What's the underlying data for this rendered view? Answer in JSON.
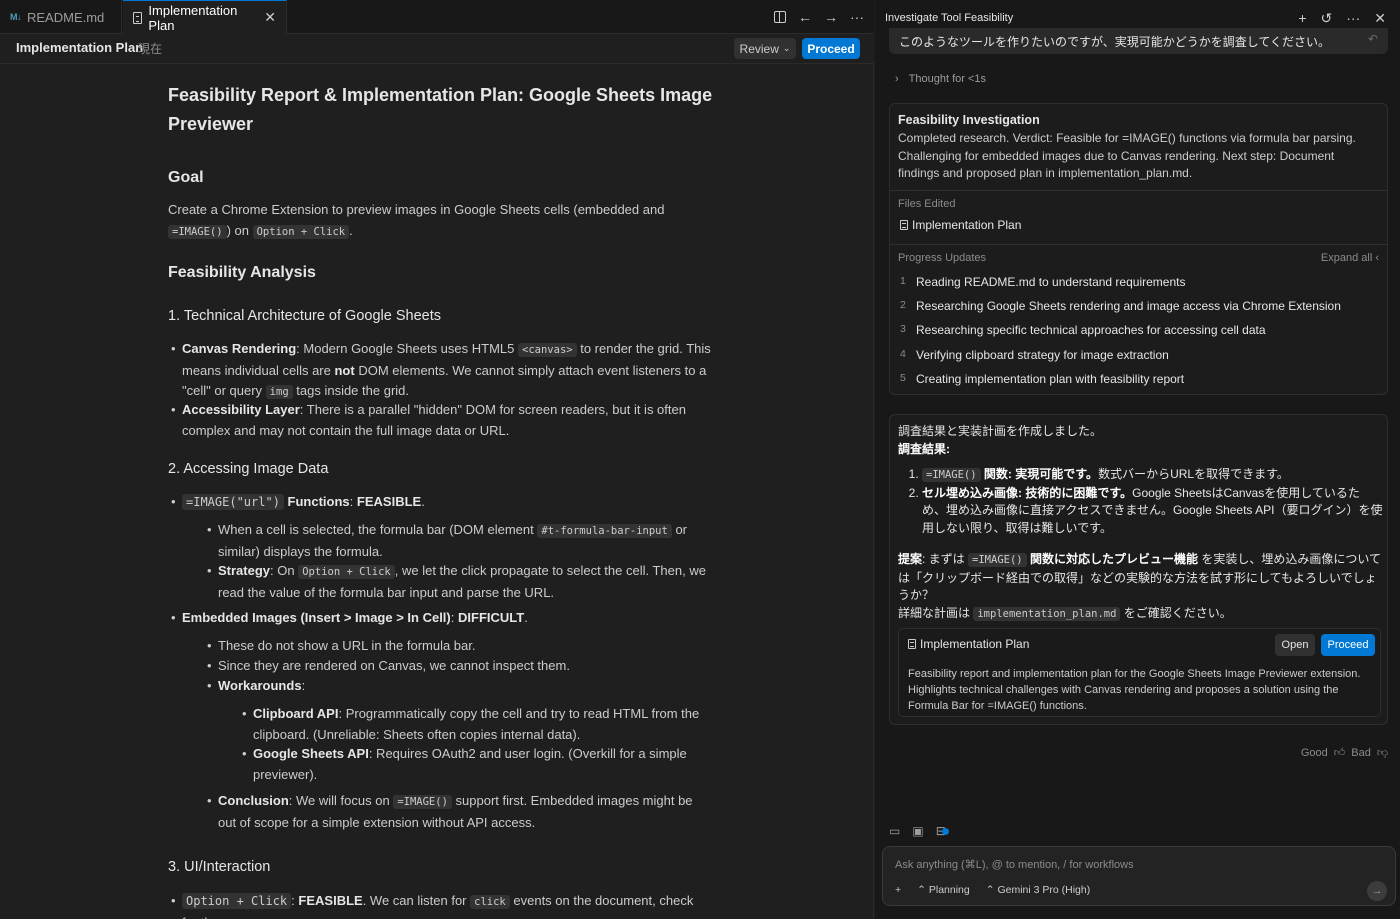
{
  "tabs": [
    {
      "label": "README.md",
      "icon": "markdown-icon"
    },
    {
      "label": "Implementation Plan",
      "icon": "file-icon"
    }
  ],
  "plan_header": {
    "title": "Implementation Plan",
    "badge": "現在",
    "review_label": "Review",
    "proceed_label": "Proceed"
  },
  "doc": {
    "title": "Feasibility Report & Implementation Plan: Google Sheets Image Previewer",
    "goal_heading": "Goal",
    "goal_text_a": "Create a Chrome Extension to preview images in Google Sheets cells (embedded and",
    "goal_code_1": "=IMAGE()",
    "goal_text_b": ") on",
    "goal_code_2": "Option + Click",
    "goal_text_c": ".",
    "feasibility_heading": "Feasibility Analysis",
    "s1_heading": "1. Technical Architecture of Google Sheets",
    "s1_b1_bold": "Canvas Rendering",
    "s1_b1_a": ": Modern Google Sheets uses HTML5",
    "s1_b1_code": "<canvas>",
    "s1_b1_b": "to render the grid. This means individual cells are",
    "s1_b1_not": "not",
    "s1_b1_c": "DOM elements. We cannot simply attach event listeners to a \"cell\" or query",
    "s1_b1_code2": "img",
    "s1_b1_d": "tags inside the grid.",
    "s1_b2_bold": "Accessibility Layer",
    "s1_b2_text": ": There is a parallel \"hidden\" DOM for screen readers, but it is often complex and may not contain the full image data or URL.",
    "s2_heading": "2. Accessing Image Data",
    "s2_b1_code": "=IMAGE(\"url\")",
    "s2_b1_bold": "Functions",
    "s2_b1_sep": ":",
    "s2_b1_status": "FEASIBLE",
    "s2_b1_end": ".",
    "s2_b1_sub1_a": "When a cell is selected, the formula bar (DOM element",
    "s2_b1_sub1_code": "#t-formula-bar-input",
    "s2_b1_sub1_b": "or similar) displays the formula.",
    "s2_b1_sub2_bold": "Strategy",
    "s2_b1_sub2_a": ": On",
    "s2_b1_sub2_code": "Option + Click",
    "s2_b1_sub2_b": ", we let the click propagate to select the cell. Then, we read the value of the formula bar input and parse the URL.",
    "s2_b2_bold": "Embedded Images (Insert > Image > In Cell)",
    "s2_b2_sep": ":",
    "s2_b2_status": "DIFFICULT",
    "s2_b2_end": ".",
    "s2_b2_sub1": "These do not show a URL in the formula bar.",
    "s2_b2_sub2": "Since they are rendered on Canvas, we cannot inspect them.",
    "s2_b2_sub3_bold": "Workarounds",
    "s2_b2_sub3_end": ":",
    "wa1_bold": "Clipboard API",
    "wa1_text": ": Programmatically copy the cell and try to read HTML from the clipboard. (Unreliable: Sheets often copies internal data).",
    "wa2_bold": "Google Sheets API",
    "wa2_text": ": Requires OAuth2 and user login. (Overkill for a simple previewer).",
    "concl_bold": "Conclusion",
    "concl_a": ": We will focus on",
    "concl_code": "=IMAGE()",
    "concl_b": "support first. Embedded images might be out of scope for a simple extension without API access.",
    "s3_heading": "3. UI/Interaction",
    "s3_b1_code": "Option + Click",
    "s3_b1_sep": ":",
    "s3_b1_status": "FEASIBLE",
    "s3_b1_a": ". We can listen for",
    "s3_b1_code2": "click",
    "s3_b1_b": "events on the document, check for the"
  },
  "chat": {
    "title": "Investigate Tool Feasibility",
    "user_message": "このようなツールを作りたいのですが、実現可能かどうかを調査してください。",
    "thought": "Thought for <1s",
    "investigation_title": "Feasibility Investigation",
    "investigation_body": "Completed research. Verdict: Feasible for =IMAGE() functions via formula bar parsing. Challenging for embedded images due to Canvas rendering. Next step: Document findings and proposed plan in implementation_plan.md.",
    "files_edited_label": "Files Edited",
    "files_edited": [
      "Implementation Plan"
    ],
    "progress_label": "Progress Updates",
    "expand_all": "Expand all",
    "steps": [
      {
        "n": "1",
        "text": "Reading README.md to understand requirements"
      },
      {
        "n": "2",
        "text": "Researching Google Sheets rendering and image access via Chrome Extension"
      },
      {
        "n": "3",
        "text": "Researching specific technical approaches for accessing cell data"
      },
      {
        "n": "4",
        "text": "Verifying clipboard strategy for image extraction"
      },
      {
        "n": "5",
        "text": "Creating implementation plan with feasibility report"
      }
    ],
    "reply_intro": "調査結果と実装計画を作成しました。",
    "reply_results": "調査結果:",
    "r1_code": "=IMAGE()",
    "r1_bold": "関数: 実現可能です。",
    "r1_text": "数式バーからURLを取得できます。",
    "r2_bold": "セル埋め込み画像: 技術的に困難です。",
    "r2_text": "Google SheetsはCanvasを使用しているため、埋め込み画像に直接アクセスできません。Google Sheets API（要ログイン）を使用しない限り、取得は難しいです。",
    "proposal_bold": "提案",
    "proposal_a": ": まずは",
    "proposal_code": "=IMAGE()",
    "proposal_bold2": "関数に対応したプレビュー機能",
    "proposal_b": "を実装し、埋め込み画像については「クリップボード経由での取得」などの実験的な方法を試す形にしてもよろしいでしょうか？",
    "proposal_c": "詳細な計画は",
    "proposal_code2": "implementation_plan.md",
    "proposal_d": "をご確認ください。",
    "impl_title": "Implementation Plan",
    "impl_open": "Open",
    "impl_proceed": "Proceed",
    "impl_desc": "Feasibility report and implementation plan for the Google Sheets Image Previewer extension. Highlights technical challenges with Canvas rendering and proposes a solution using the Formula Bar for =IMAGE() functions.",
    "good": "Good",
    "bad": "Bad",
    "input_placeholder": "Ask anything (⌘L), @ to mention, / for workflows",
    "mode": "Planning",
    "model": "Gemini 3 Pro (High)"
  },
  "colors": {
    "accent": "#0078d4",
    "background": "#1e1e1e",
    "panel": "#181818"
  }
}
